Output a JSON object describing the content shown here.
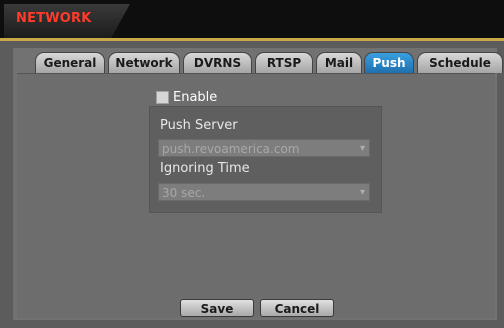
{
  "window": {
    "title": "NETWORK"
  },
  "tabs": [
    {
      "label": "General"
    },
    {
      "label": "Network"
    },
    {
      "label": "DVRNS"
    },
    {
      "label": "RTSP"
    },
    {
      "label": "Mail"
    },
    {
      "label": "Push",
      "active": true
    },
    {
      "label": "Schedule"
    }
  ],
  "push": {
    "enable_label": "Enable",
    "enabled": false,
    "server_label": "Push Server",
    "server_value": "push.revoamerica.com",
    "ignoring_label": "Ignoring Time",
    "ignoring_value": "30 sec."
  },
  "buttons": {
    "save": "Save",
    "cancel": "Cancel"
  },
  "colors": {
    "title_text": "#ff3b2a",
    "title_accent_line": "#c9a84a",
    "active_tab": "#2a86c8"
  },
  "icons": {
    "dropdown": "chevron-down-icon"
  }
}
